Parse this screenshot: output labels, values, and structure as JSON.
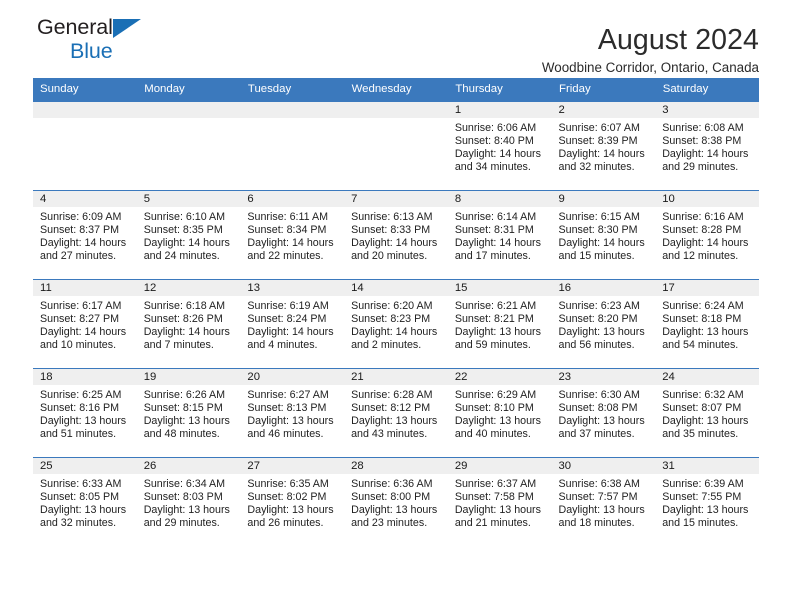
{
  "brand": {
    "line1": "General",
    "line2": "Blue",
    "accent_color": "#1a6fb5"
  },
  "header": {
    "title": "August 2024",
    "subtitle": "Woodbine Corridor, Ontario, Canada",
    "header_bg": "#3b79bd"
  },
  "calendar": {
    "weekday_headers": [
      "Sunday",
      "Monday",
      "Tuesday",
      "Wednesday",
      "Thursday",
      "Friday",
      "Saturday"
    ],
    "weeks": [
      [
        {
          "day": "",
          "empty": true
        },
        {
          "day": "",
          "empty": true
        },
        {
          "day": "",
          "empty": true
        },
        {
          "day": "",
          "empty": true
        },
        {
          "day": "1",
          "sunrise": "Sunrise: 6:06 AM",
          "sunset": "Sunset: 8:40 PM",
          "daylight1": "Daylight: 14 hours",
          "daylight2": "and 34 minutes."
        },
        {
          "day": "2",
          "sunrise": "Sunrise: 6:07 AM",
          "sunset": "Sunset: 8:39 PM",
          "daylight1": "Daylight: 14 hours",
          "daylight2": "and 32 minutes."
        },
        {
          "day": "3",
          "sunrise": "Sunrise: 6:08 AM",
          "sunset": "Sunset: 8:38 PM",
          "daylight1": "Daylight: 14 hours",
          "daylight2": "and 29 minutes."
        }
      ],
      [
        {
          "day": "4",
          "sunrise": "Sunrise: 6:09 AM",
          "sunset": "Sunset: 8:37 PM",
          "daylight1": "Daylight: 14 hours",
          "daylight2": "and 27 minutes."
        },
        {
          "day": "5",
          "sunrise": "Sunrise: 6:10 AM",
          "sunset": "Sunset: 8:35 PM",
          "daylight1": "Daylight: 14 hours",
          "daylight2": "and 24 minutes."
        },
        {
          "day": "6",
          "sunrise": "Sunrise: 6:11 AM",
          "sunset": "Sunset: 8:34 PM",
          "daylight1": "Daylight: 14 hours",
          "daylight2": "and 22 minutes."
        },
        {
          "day": "7",
          "sunrise": "Sunrise: 6:13 AM",
          "sunset": "Sunset: 8:33 PM",
          "daylight1": "Daylight: 14 hours",
          "daylight2": "and 20 minutes."
        },
        {
          "day": "8",
          "sunrise": "Sunrise: 6:14 AM",
          "sunset": "Sunset: 8:31 PM",
          "daylight1": "Daylight: 14 hours",
          "daylight2": "and 17 minutes."
        },
        {
          "day": "9",
          "sunrise": "Sunrise: 6:15 AM",
          "sunset": "Sunset: 8:30 PM",
          "daylight1": "Daylight: 14 hours",
          "daylight2": "and 15 minutes."
        },
        {
          "day": "10",
          "sunrise": "Sunrise: 6:16 AM",
          "sunset": "Sunset: 8:28 PM",
          "daylight1": "Daylight: 14 hours",
          "daylight2": "and 12 minutes."
        }
      ],
      [
        {
          "day": "11",
          "sunrise": "Sunrise: 6:17 AM",
          "sunset": "Sunset: 8:27 PM",
          "daylight1": "Daylight: 14 hours",
          "daylight2": "and 10 minutes."
        },
        {
          "day": "12",
          "sunrise": "Sunrise: 6:18 AM",
          "sunset": "Sunset: 8:26 PM",
          "daylight1": "Daylight: 14 hours",
          "daylight2": "and 7 minutes."
        },
        {
          "day": "13",
          "sunrise": "Sunrise: 6:19 AM",
          "sunset": "Sunset: 8:24 PM",
          "daylight1": "Daylight: 14 hours",
          "daylight2": "and 4 minutes."
        },
        {
          "day": "14",
          "sunrise": "Sunrise: 6:20 AM",
          "sunset": "Sunset: 8:23 PM",
          "daylight1": "Daylight: 14 hours",
          "daylight2": "and 2 minutes."
        },
        {
          "day": "15",
          "sunrise": "Sunrise: 6:21 AM",
          "sunset": "Sunset: 8:21 PM",
          "daylight1": "Daylight: 13 hours",
          "daylight2": "and 59 minutes."
        },
        {
          "day": "16",
          "sunrise": "Sunrise: 6:23 AM",
          "sunset": "Sunset: 8:20 PM",
          "daylight1": "Daylight: 13 hours",
          "daylight2": "and 56 minutes."
        },
        {
          "day": "17",
          "sunrise": "Sunrise: 6:24 AM",
          "sunset": "Sunset: 8:18 PM",
          "daylight1": "Daylight: 13 hours",
          "daylight2": "and 54 minutes."
        }
      ],
      [
        {
          "day": "18",
          "sunrise": "Sunrise: 6:25 AM",
          "sunset": "Sunset: 8:16 PM",
          "daylight1": "Daylight: 13 hours",
          "daylight2": "and 51 minutes."
        },
        {
          "day": "19",
          "sunrise": "Sunrise: 6:26 AM",
          "sunset": "Sunset: 8:15 PM",
          "daylight1": "Daylight: 13 hours",
          "daylight2": "and 48 minutes."
        },
        {
          "day": "20",
          "sunrise": "Sunrise: 6:27 AM",
          "sunset": "Sunset: 8:13 PM",
          "daylight1": "Daylight: 13 hours",
          "daylight2": "and 46 minutes."
        },
        {
          "day": "21",
          "sunrise": "Sunrise: 6:28 AM",
          "sunset": "Sunset: 8:12 PM",
          "daylight1": "Daylight: 13 hours",
          "daylight2": "and 43 minutes."
        },
        {
          "day": "22",
          "sunrise": "Sunrise: 6:29 AM",
          "sunset": "Sunset: 8:10 PM",
          "daylight1": "Daylight: 13 hours",
          "daylight2": "and 40 minutes."
        },
        {
          "day": "23",
          "sunrise": "Sunrise: 6:30 AM",
          "sunset": "Sunset: 8:08 PM",
          "daylight1": "Daylight: 13 hours",
          "daylight2": "and 37 minutes."
        },
        {
          "day": "24",
          "sunrise": "Sunrise: 6:32 AM",
          "sunset": "Sunset: 8:07 PM",
          "daylight1": "Daylight: 13 hours",
          "daylight2": "and 35 minutes."
        }
      ],
      [
        {
          "day": "25",
          "sunrise": "Sunrise: 6:33 AM",
          "sunset": "Sunset: 8:05 PM",
          "daylight1": "Daylight: 13 hours",
          "daylight2": "and 32 minutes."
        },
        {
          "day": "26",
          "sunrise": "Sunrise: 6:34 AM",
          "sunset": "Sunset: 8:03 PM",
          "daylight1": "Daylight: 13 hours",
          "daylight2": "and 29 minutes."
        },
        {
          "day": "27",
          "sunrise": "Sunrise: 6:35 AM",
          "sunset": "Sunset: 8:02 PM",
          "daylight1": "Daylight: 13 hours",
          "daylight2": "and 26 minutes."
        },
        {
          "day": "28",
          "sunrise": "Sunrise: 6:36 AM",
          "sunset": "Sunset: 8:00 PM",
          "daylight1": "Daylight: 13 hours",
          "daylight2": "and 23 minutes."
        },
        {
          "day": "29",
          "sunrise": "Sunrise: 6:37 AM",
          "sunset": "Sunset: 7:58 PM",
          "daylight1": "Daylight: 13 hours",
          "daylight2": "and 21 minutes."
        },
        {
          "day": "30",
          "sunrise": "Sunrise: 6:38 AM",
          "sunset": "Sunset: 7:57 PM",
          "daylight1": "Daylight: 13 hours",
          "daylight2": "and 18 minutes."
        },
        {
          "day": "31",
          "sunrise": "Sunrise: 6:39 AM",
          "sunset": "Sunset: 7:55 PM",
          "daylight1": "Daylight: 13 hours",
          "daylight2": "and 15 minutes."
        }
      ]
    ]
  }
}
